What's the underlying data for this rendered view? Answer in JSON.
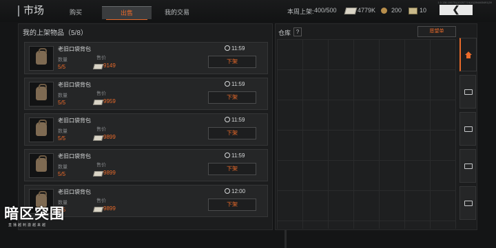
{
  "header": {
    "title": "市场",
    "tabs": [
      {
        "label": "购买",
        "active": false
      },
      {
        "label": "出售",
        "active": true
      },
      {
        "label": "我的交易",
        "active": false
      }
    ],
    "weekly_label": "本周上架:",
    "weekly_value": "400/500",
    "cash": "4779K",
    "coins": "200",
    "bonds": "10",
    "version": "1.0.136.106751|10257719|10|394465491|39",
    "back_icon": "chevron-left-icon"
  },
  "left_panel": {
    "title": "我的上架物品（5/8）",
    "qty_label": "数量",
    "price_label": "售价",
    "delist_label": "下架",
    "listings": [
      {
        "name": "老旧口袋背包",
        "qty": "5/5",
        "price": "9149",
        "time": "11:59"
      },
      {
        "name": "老旧口袋背包",
        "qty": "5/5",
        "price": "9959",
        "time": "11:59"
      },
      {
        "name": "老旧口袋背包",
        "qty": "5/5",
        "price": "9899",
        "time": "11:59"
      },
      {
        "name": "老旧口袋背包",
        "qty": "5/5",
        "price": "9899",
        "time": "11:59"
      },
      {
        "name": "老旧口袋背包",
        "qty": "5/5",
        "price": "9899",
        "time": "12:00"
      }
    ]
  },
  "right_panel": {
    "title": "仓库",
    "help": "?",
    "wishlist_label": "愿望单"
  },
  "side_tabs": [
    "home-icon",
    "box-icon",
    "box-icon",
    "box-icon",
    "box-icon"
  ],
  "watermark": {
    "main": "暗区突围",
    "sub": "直播越刺激越来越"
  },
  "colors": {
    "accent": "#e96a2a",
    "panel": "#1c1d1e"
  }
}
